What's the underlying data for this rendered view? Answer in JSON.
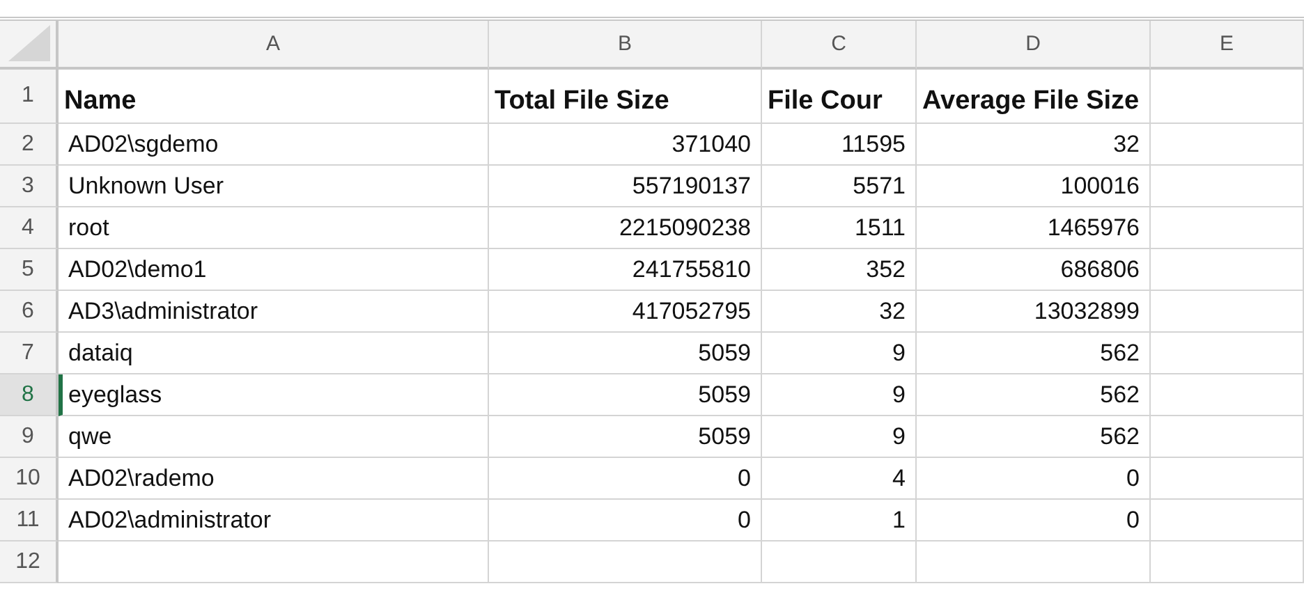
{
  "columns": [
    "A",
    "B",
    "C",
    "D",
    "E"
  ],
  "rows": [
    {
      "number": "1",
      "selected": false,
      "kind": "header",
      "cells": [
        "Name",
        "Total File Size",
        "File Cour",
        "Average File Size",
        ""
      ]
    },
    {
      "number": "2",
      "selected": false,
      "kind": "data",
      "cells": [
        "AD02\\sgdemo",
        "371040",
        "11595",
        "32",
        ""
      ]
    },
    {
      "number": "3",
      "selected": false,
      "kind": "data",
      "cells": [
        "Unknown User",
        "557190137",
        "5571",
        "100016",
        ""
      ]
    },
    {
      "number": "4",
      "selected": false,
      "kind": "data",
      "cells": [
        "root",
        "2215090238",
        "1511",
        "1465976",
        ""
      ]
    },
    {
      "number": "5",
      "selected": false,
      "kind": "data",
      "cells": [
        "AD02\\demo1",
        "241755810",
        "352",
        "686806",
        ""
      ]
    },
    {
      "number": "6",
      "selected": false,
      "kind": "data",
      "cells": [
        "AD3\\administrator",
        "417052795",
        "32",
        "13032899",
        ""
      ]
    },
    {
      "number": "7",
      "selected": false,
      "kind": "data",
      "cells": [
        "dataiq",
        "5059",
        "9",
        "562",
        ""
      ]
    },
    {
      "number": "8",
      "selected": true,
      "kind": "data",
      "cells": [
        "eyeglass",
        "5059",
        "9",
        "562",
        ""
      ]
    },
    {
      "number": "9",
      "selected": false,
      "kind": "data",
      "cells": [
        "qwe",
        "5059",
        "9",
        "562",
        ""
      ]
    },
    {
      "number": "10",
      "selected": false,
      "kind": "data",
      "cells": [
        "AD02\\rademo",
        "0",
        "4",
        "0",
        ""
      ]
    },
    {
      "number": "11",
      "selected": false,
      "kind": "data",
      "cells": [
        "AD02\\administrator",
        "0",
        "1",
        "0",
        ""
      ]
    },
    {
      "number": "12",
      "selected": false,
      "kind": "data",
      "cells": [
        "",
        "",
        "",
        "",
        ""
      ]
    }
  ]
}
